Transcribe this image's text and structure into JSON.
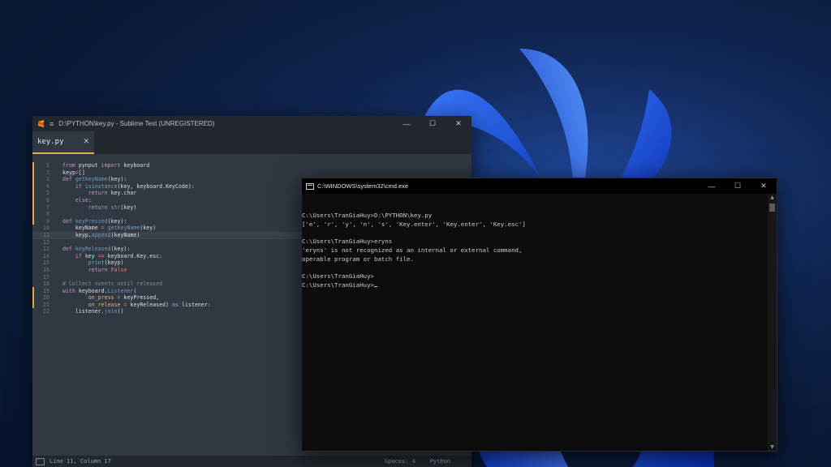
{
  "sublime": {
    "title": "D:\\PYTHON\\key.py - Sublime Text (UNREGISTERED)",
    "tab_label": "key.py",
    "close_glyph": "✕",
    "menu_glyph": "≡",
    "win_minimize": "—",
    "win_maximize": "☐",
    "win_close": "✕",
    "status_position": "Line 11, Column 17",
    "status_spaces": "Spaces: 4",
    "status_syntax": "Python",
    "active_line": 11,
    "code_lines": [
      {
        "n": "1",
        "t": "from pynput import keyboard"
      },
      {
        "n": "2",
        "t": "keyp=[]"
      },
      {
        "n": "3",
        "t": "def getKeyName(key):"
      },
      {
        "n": "4",
        "t": "    if isinstance(key, keyboard.KeyCode):"
      },
      {
        "n": "5",
        "t": "        return key.char"
      },
      {
        "n": "6",
        "t": "    else:"
      },
      {
        "n": "7",
        "t": "        return str(key)"
      },
      {
        "n": "8",
        "t": ""
      },
      {
        "n": "9",
        "t": "def keyPressed(key):"
      },
      {
        "n": "10",
        "t": "    keyName = getKeyName(key)"
      },
      {
        "n": "11",
        "t": "    keyp.append(keyName)"
      },
      {
        "n": "12",
        "t": ""
      },
      {
        "n": "13",
        "t": "def keyReleased(key):"
      },
      {
        "n": "14",
        "t": "    if key == keyboard.Key.esc:"
      },
      {
        "n": "15",
        "t": "        print(keyp)"
      },
      {
        "n": "16",
        "t": "        return False"
      },
      {
        "n": "17",
        "t": ""
      },
      {
        "n": "18",
        "t": "# Collect events until released"
      },
      {
        "n": "19",
        "t": "with keyboard.Listener("
      },
      {
        "n": "20",
        "t": "        on_press = keyPressed,"
      },
      {
        "n": "21",
        "t": "        on_release = keyReleased) as listener:"
      },
      {
        "n": "22",
        "t": "    listener.join()"
      }
    ]
  },
  "cmd": {
    "title": "C:\\WINDOWS\\system32\\cmd.exe",
    "win_minimize": "—",
    "win_maximize": "☐",
    "win_close": "✕",
    "lines": [
      "",
      "C:\\Users\\TranGiaHuy>D:\\PYTHON\\key.py",
      "['e', 'r', 'y', 'n', 's', 'Key.enter', 'Key.enter', 'Key.esc']",
      "",
      "C:\\Users\\TranGiaHuy>eryns",
      "'eryns' is not recognized as an internal or external command,",
      "operable program or batch file.",
      "",
      "C:\\Users\\TranGiaHuy>",
      "C:\\Users\\TranGiaHuy>"
    ],
    "scroll_up": "▲",
    "scroll_down": "▼"
  },
  "colors": {
    "accent": "#e8a83e",
    "sublime_bg": "#303841",
    "cmd_bg": "#0c0c0c"
  }
}
